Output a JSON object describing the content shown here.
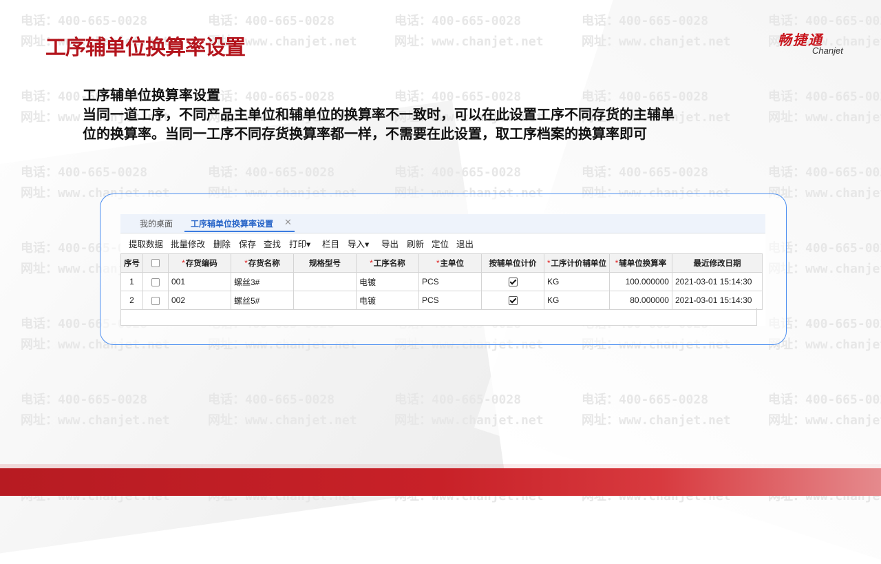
{
  "title": "工序辅单位换算率设置",
  "logo": {
    "cn": "畅捷通",
    "en": "Chanjet"
  },
  "watermark": {
    "phone": "电话：400-665-0028",
    "site": "网址：www.chanjet.net"
  },
  "content": {
    "heading": "工序辅单位换算率设置",
    "line1": "当同一道工序，不同产品主单位和辅单位的换算率不一致时，可以在此设置工序不同存货的主辅单",
    "line2": "位的换算率。当同一工序不同存货换算率都一样，不需要在此设置，取工序档案的换算率即可"
  },
  "app": {
    "tabs": {
      "home": "我的桌面",
      "active": "工序辅单位换算率设置",
      "close": "✕"
    },
    "toolbar": {
      "fetch": "提取数据",
      "batch": "批量修改",
      "delete": "删除",
      "save": "保存",
      "find": "查找",
      "print": "打印",
      "columns": "栏目",
      "import": "导入",
      "export": "导出",
      "refresh": "刷新",
      "locate": "定位",
      "exit": "退出",
      "caret": "▾"
    },
    "table": {
      "required_mark": "*",
      "headers": {
        "seq": "序号",
        "code": "存货编码",
        "name": "存货名称",
        "spec": "规格型号",
        "process": "工序名称",
        "unit": "主单位",
        "price_by_aux": "按辅单位计价",
        "process_aux_unit": "工序计价辅单位",
        "rate": "辅单位换算率",
        "modified": "最近修改日期"
      },
      "rows": [
        {
          "seq": "1",
          "code": "001",
          "name": "螺丝3#",
          "spec": "",
          "process": "电镀",
          "unit": "PCS",
          "price_by_aux": true,
          "process_aux_unit": "KG",
          "rate": "100.000000",
          "modified": "2021-03-01 15:14:30"
        },
        {
          "seq": "2",
          "code": "002",
          "name": "螺丝5#",
          "spec": "",
          "process": "电镀",
          "unit": "PCS",
          "price_by_aux": true,
          "process_aux_unit": "KG",
          "rate": "80.000000",
          "modified": "2021-03-01 15:14:30"
        }
      ]
    }
  },
  "colors": {
    "brand_red": "#b3141c",
    "accent_blue": "#3b7be0",
    "frame_blue": "#4b8ef0"
  }
}
